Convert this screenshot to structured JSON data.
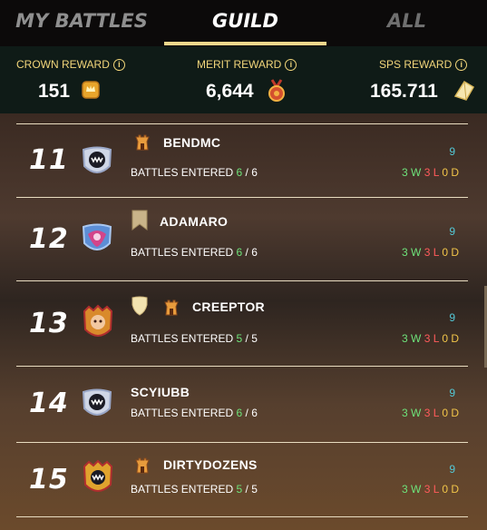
{
  "tabs": [
    {
      "label": "MY BATTLES"
    },
    {
      "label": "GUILD"
    },
    {
      "label": "ALL"
    }
  ],
  "active_tab": "GUILD",
  "rewards": {
    "crown": {
      "label": "CROWN REWARD",
      "value": "151",
      "icon": "crown-reward-icon"
    },
    "merit": {
      "label": "MERIT REWARD",
      "value": "6,644",
      "icon": "merit-medal-icon"
    },
    "sps": {
      "label": "SPS REWARD",
      "value": "165.711",
      "icon": "sps-crystal-icon"
    }
  },
  "info_glyph": "i",
  "players": [
    {
      "rank": "11",
      "name": "BENDMC",
      "battles_label": "BATTLES ENTERED",
      "entered": "6",
      "total": "6",
      "score": "9",
      "wins": "3 W",
      "losses": "3 L",
      "draws": "0 D"
    },
    {
      "rank": "12",
      "name": "ADAMARO",
      "battles_label": "BATTLES ENTERED",
      "entered": "6",
      "total": "6",
      "score": "9",
      "wins": "3 W",
      "losses": "3 L",
      "draws": "0 D"
    },
    {
      "rank": "13",
      "name": "CREEPTOR",
      "battles_label": "BATTLES ENTERED",
      "entered": "5",
      "total": "5",
      "score": "9",
      "wins": "3 W",
      "losses": "3 L",
      "draws": "0 D"
    },
    {
      "rank": "14",
      "name": "SCYIUBB",
      "battles_label": "BATTLES ENTERED",
      "entered": "6",
      "total": "6",
      "score": "9",
      "wins": "3 W",
      "losses": "3 L",
      "draws": "0 D"
    },
    {
      "rank": "15",
      "name": "DIRTYDOZENS",
      "battles_label": "BATTLES ENTERED",
      "entered": "5",
      "total": "5",
      "score": "9",
      "wins": "3 W",
      "losses": "3 L",
      "draws": "0 D"
    }
  ],
  "colors": {
    "accent": "#f0d78c",
    "win": "#6ee27a",
    "loss": "#ff5b5b",
    "draw": "#f1c549",
    "score": "#53c8d6"
  }
}
